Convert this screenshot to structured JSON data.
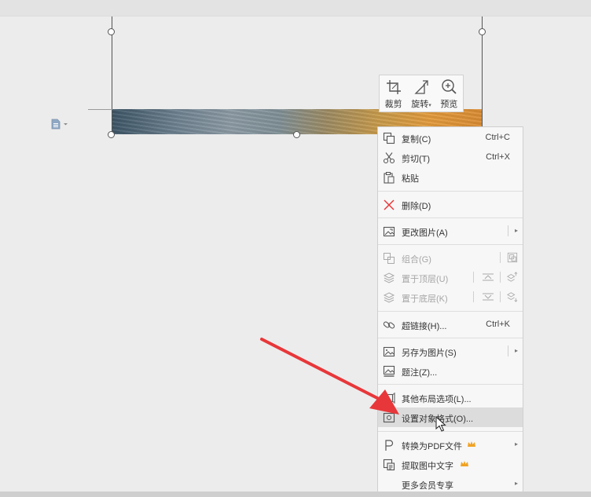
{
  "mini_toolbar": {
    "crop_label": "裁剪",
    "rotate_label": "旋转",
    "rotate_caret": "▾",
    "preview_label": "预览"
  },
  "context_menu": {
    "copy": {
      "label": "复制(C)",
      "shortcut": "Ctrl+C"
    },
    "cut": {
      "label": "剪切(T)",
      "shortcut": "Ctrl+X"
    },
    "paste": {
      "label": "粘贴"
    },
    "delete": {
      "label": "删除(D)"
    },
    "change_picture": {
      "label": "更改图片(A)"
    },
    "group": {
      "label": "组合(G)"
    },
    "bring_to_front": {
      "label": "置于顶层(U)"
    },
    "send_to_back": {
      "label": "置于底层(K)"
    },
    "hyperlink": {
      "label": "超链接(H)...",
      "shortcut": "Ctrl+K"
    },
    "save_as_picture": {
      "label": "另存为图片(S)"
    },
    "caption": {
      "label": "题注(Z)..."
    },
    "other_layout": {
      "label": "其他布局选项(L)..."
    },
    "format_object": {
      "label": "设置对象格式(O)..."
    },
    "convert_pdf": {
      "label": "转换为PDF文件"
    },
    "extract_text": {
      "label": "提取图中文字"
    },
    "more_member": {
      "label": "更多会员专享"
    }
  },
  "colors": {
    "accent_red": "#e8373a",
    "crown_gold": "#f0a324"
  },
  "icons": {
    "doc": "document-icon",
    "crop": "crop-icon",
    "rotate": "rotate-icon",
    "preview": "zoom-in-icon"
  }
}
